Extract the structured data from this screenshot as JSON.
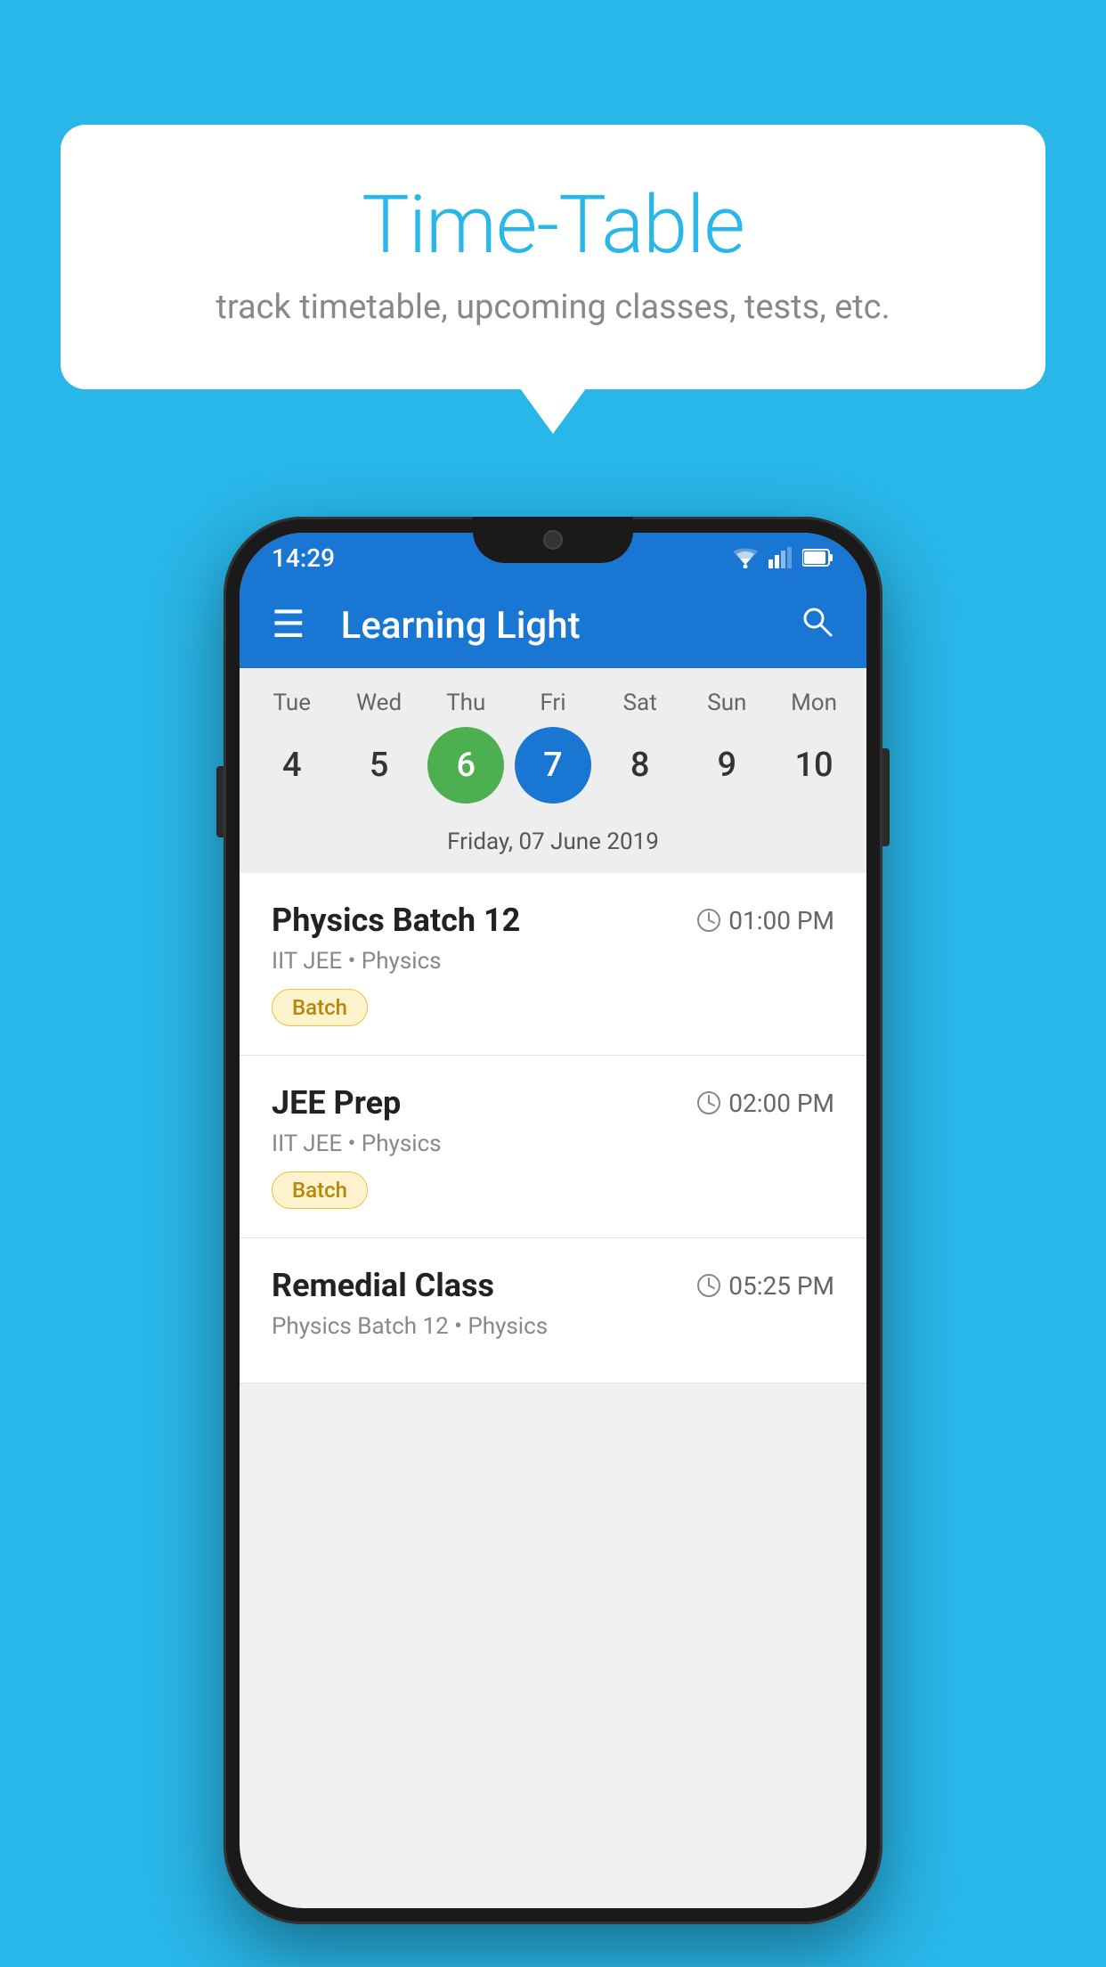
{
  "background_color": "#29B6E8",
  "speech_bubble": {
    "title": "Time-Table",
    "subtitle": "track timetable, upcoming classes, tests, etc."
  },
  "phone": {
    "status_bar": {
      "time": "14:29"
    },
    "app_bar": {
      "title": "Learning Light"
    },
    "calendar": {
      "weekdays": [
        "Tue",
        "Wed",
        "Thu",
        "Fri",
        "Sat",
        "Sun",
        "Mon"
      ],
      "dates": [
        "4",
        "5",
        "6",
        "7",
        "8",
        "9",
        "10"
      ],
      "today_index": 2,
      "selected_index": 3,
      "selected_label": "Friday, 07 June 2019"
    },
    "schedule": [
      {
        "title": "Physics Batch 12",
        "time": "01:00 PM",
        "subtitle": "IIT JEE • Physics",
        "badge": "Batch"
      },
      {
        "title": "JEE Prep",
        "time": "02:00 PM",
        "subtitle": "IIT JEE • Physics",
        "badge": "Batch"
      },
      {
        "title": "Remedial Class",
        "time": "05:25 PM",
        "subtitle": "Physics Batch 12 • Physics",
        "badge": null
      }
    ]
  },
  "icons": {
    "hamburger": "☰",
    "search": "🔍",
    "clock": "🕐"
  }
}
